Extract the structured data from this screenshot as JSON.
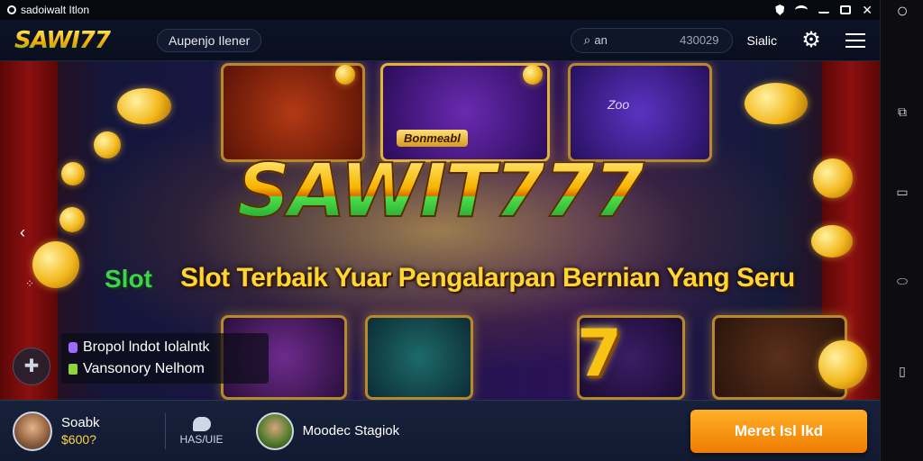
{
  "statusbar": {
    "app_name": "sadoiwalt Itlon"
  },
  "header": {
    "logo": "SAWI77",
    "pill_label": "Aupenjo Ilener",
    "search_value": "an",
    "search_number": "430029",
    "label": "Sialic"
  },
  "hero": {
    "tile_label_center": "Bonmeabl",
    "tile_label_right": "Zoo",
    "title": "SAWIT777",
    "slot_word": "Slot",
    "subtitle": "Slot Terbaik Yuar Pengalarpan Bernian Yang Seru",
    "seven": "7",
    "info_line1": "Bropol lndot Iolalntk",
    "info_line2": "Vansonory Nelhom"
  },
  "bottombar": {
    "user_name": "Soabk",
    "user_amount": "$600?",
    "chat_label": "HAS/UIE",
    "player2_name": "Moodec Stagiok",
    "cta_label": "Meret Isl lkd"
  },
  "colors": {
    "accent": "#f59a10",
    "brand_green": "#3fd34d",
    "brand_gold": "#f7b400"
  },
  "icons": [
    "app-icon",
    "shield-icon",
    "wifi-icon",
    "minimize-icon",
    "maximize-icon",
    "close-icon",
    "search-icon",
    "gear-icon",
    "menu-icon",
    "left-arrow-icon",
    "puzzle-icon",
    "chat-icon",
    "home-icon",
    "recent-apps-icon",
    "back-icon",
    "tabs-icon",
    "trash-icon"
  ]
}
